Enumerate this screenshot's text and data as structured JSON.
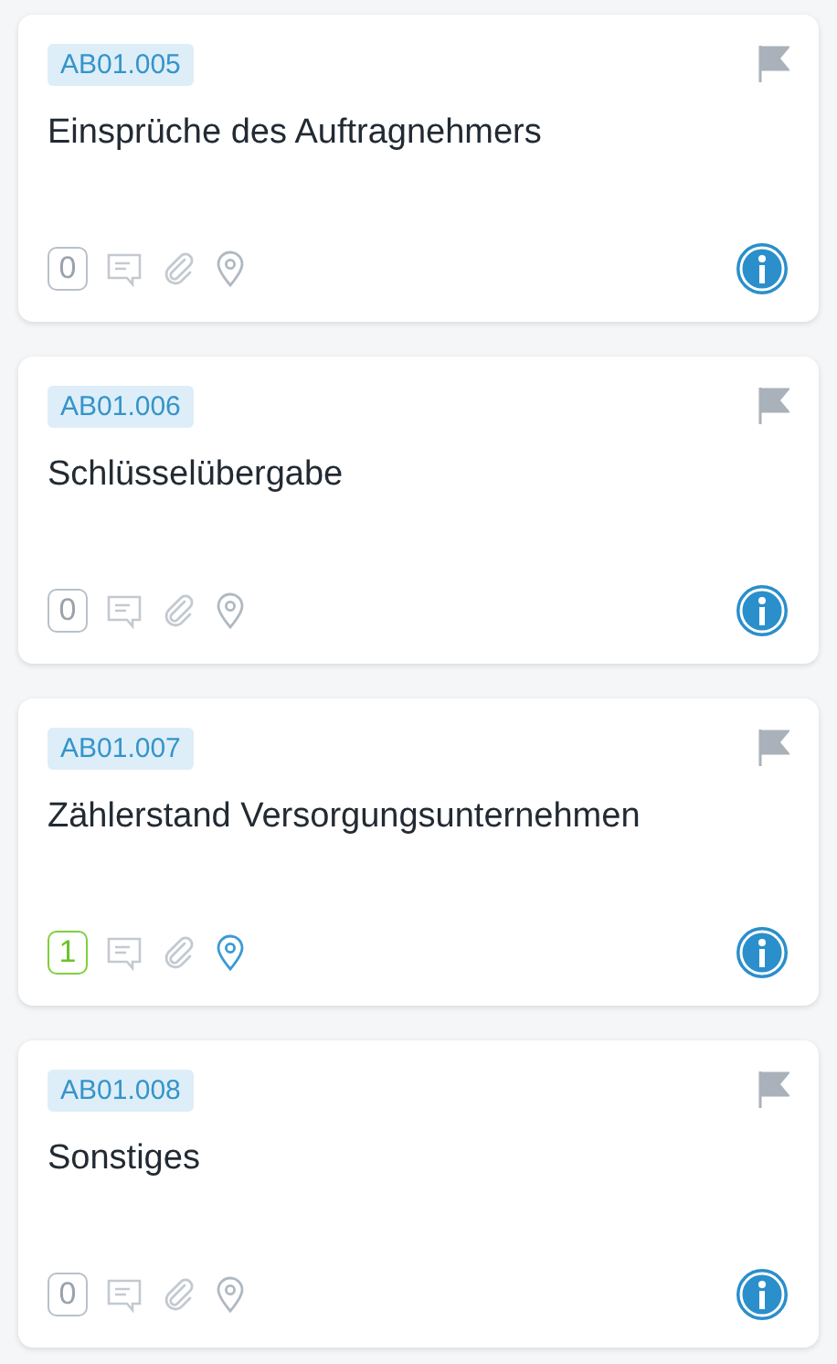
{
  "cards": [
    {
      "code": "AB01.005",
      "title": "Einsprüche des Auftragnehmers",
      "count": "0",
      "count_active": false,
      "location_set": false
    },
    {
      "code": "AB01.006",
      "title": "Schlüsselübergabe",
      "count": "0",
      "count_active": false,
      "location_set": false
    },
    {
      "code": "AB01.007",
      "title": "Zählerstand Versorgungsunternehmen",
      "count": "1",
      "count_active": true,
      "location_set": true
    },
    {
      "code": "AB01.008",
      "title": "Sonstiges",
      "count": "0",
      "count_active": false,
      "location_set": false
    }
  ]
}
